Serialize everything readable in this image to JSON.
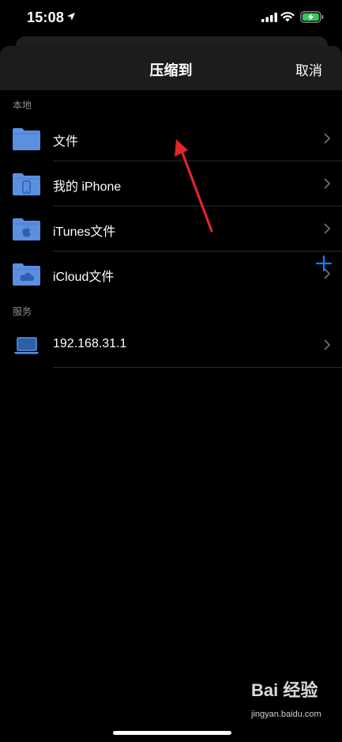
{
  "status_bar": {
    "time": "15:08"
  },
  "sheet": {
    "title": "压缩到",
    "cancel_label": "取消"
  },
  "sections": {
    "local_header": "本地",
    "services_header": "服务"
  },
  "local_items": [
    {
      "label": "文件",
      "icon": "folder-icon"
    },
    {
      "label": "我的 iPhone",
      "icon": "iphone-folder-icon"
    },
    {
      "label": "iTunes文件",
      "icon": "apple-folder-icon"
    },
    {
      "label": "iCloud文件",
      "icon": "cloud-folder-icon"
    }
  ],
  "service_items": [
    {
      "label": "192.168.31.1",
      "icon": "laptop-icon"
    }
  ],
  "watermark": {
    "logo": "Bai 经验",
    "url": "jingyan.baidu.com"
  },
  "colors": {
    "folder": "#5b8fe0",
    "accent": "#0a84ff",
    "arrow": "#e0252c",
    "battery": "#34c759"
  }
}
